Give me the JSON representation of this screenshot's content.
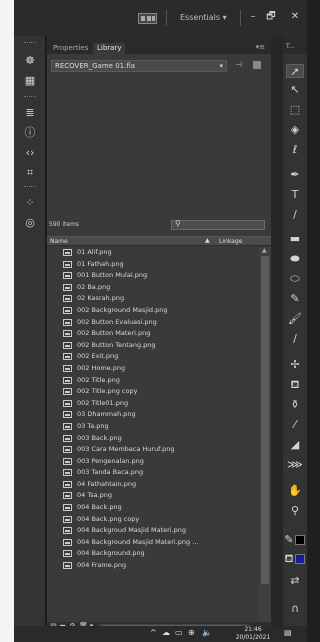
{
  "titlebar": {
    "workspace": "Essentials",
    "workspace_arrow": "▾",
    "minimize": "–",
    "restore": "🗗",
    "close": "✕"
  },
  "panel": {
    "tabs": [
      "Properties",
      "Library"
    ],
    "active_tab": "Library",
    "menu_icon": "▾≡",
    "document": "RECOVER_Game 01.fla",
    "item_count": "590 items",
    "search_placeholder": "",
    "columns": {
      "name": "Name",
      "linkage": "Linkage",
      "sort": "▲"
    },
    "items": [
      "01 Alif.png",
      "01 Fathah.png",
      "001 Button Mulai.png",
      "02 Ba.png",
      "02 Kasrah.png",
      "002 Background Masjid.png",
      "002 Button Evaluasi.png",
      "002 Button Materi.png",
      "002 Button Tentang.png",
      "002 Exit.png",
      "002 Home.png",
      "002 Title.png",
      "002 Title.png copy",
      "002 Title01.png",
      "03 Dhammah.png",
      "03 Ta.png",
      "003 Back.png",
      "003 Cara Membaca Huruf.png",
      "003 Pengenalan.png",
      "003 Tanda Baca.png",
      "04 Fathahtain.png",
      "04 Tsa.png",
      "004 Back.png",
      "004 Back.png copy",
      "004 Backgroud Masjid Materi.png",
      "004 Background Masjid Materi.png ...",
      "004 Background.png",
      "004 Frame.png"
    ]
  },
  "right_panel_header": "T...",
  "colors": {
    "stroke_swatch": "#000000",
    "fill_swatch": "#1a1aa0"
  },
  "taskbar": {
    "time": "21:46",
    "date": "20/01/2021",
    "volume_label": "))"
  }
}
